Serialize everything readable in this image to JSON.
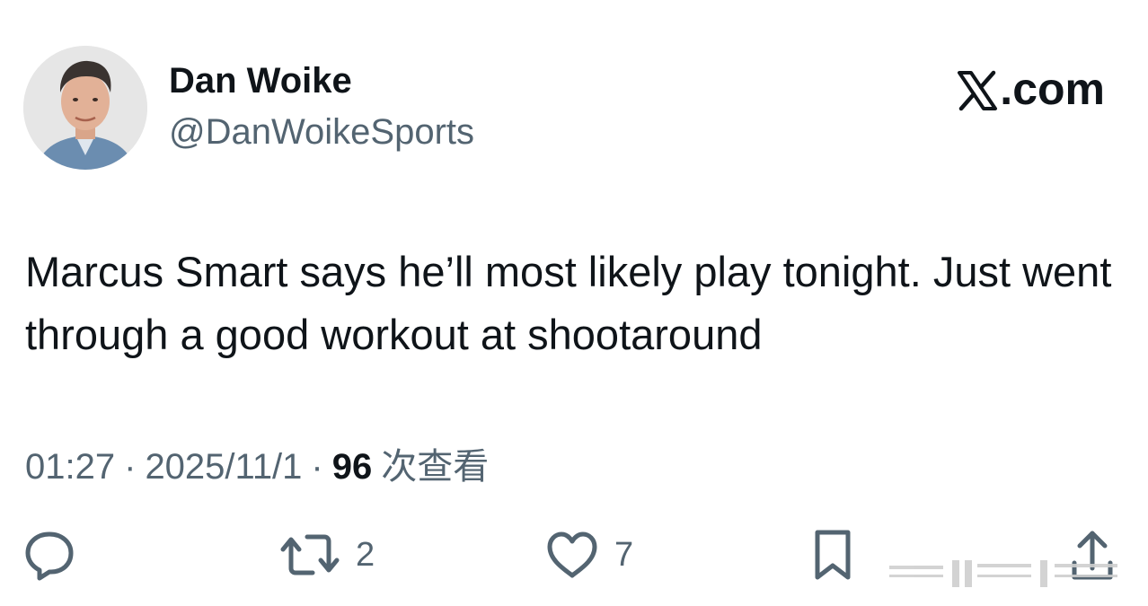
{
  "author": {
    "name": "Dan Woike",
    "handle": "@DanWoikeSports"
  },
  "site_logo": {
    "text": ".com",
    "icon": "x-logo-icon"
  },
  "tweet": {
    "text": "Marcus Smart says he’ll most likely play tonight. Just went through a good workout at shootaround"
  },
  "meta": {
    "time": "01:27",
    "separator": "·",
    "date": "2025/11/1",
    "views_count": "96",
    "views_label": "次查看"
  },
  "actions": {
    "reply": {
      "icon": "reply-icon"
    },
    "retweet": {
      "icon": "retweet-icon",
      "count": "2"
    },
    "like": {
      "icon": "heart-icon",
      "count": "7"
    },
    "bookmark": {
      "icon": "bookmark-icon"
    },
    "share": {
      "icon": "share-icon"
    }
  },
  "colors": {
    "text_primary": "#0f1419",
    "text_secondary": "#536471",
    "background": "#ffffff"
  }
}
